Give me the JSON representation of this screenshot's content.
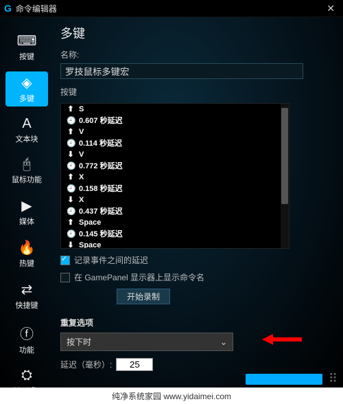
{
  "window": {
    "title": "命令编辑器"
  },
  "sidebar": {
    "items": [
      {
        "icon": "⌨",
        "label": "按键"
      },
      {
        "icon": "◈",
        "label": "多键"
      },
      {
        "icon": "A",
        "label": "文本块"
      },
      {
        "icon": "🖰",
        "label": "鼠标功能"
      },
      {
        "icon": "▶",
        "label": "媒体"
      },
      {
        "icon": "🔥",
        "label": "热键"
      },
      {
        "icon": "⇄",
        "label": "快捷键"
      },
      {
        "icon": "ⓕ",
        "label": "功能"
      },
      {
        "icon": "⛭",
        "label": "Ventrilo"
      }
    ]
  },
  "main": {
    "heading": "多键",
    "name_label": "名称:",
    "name_value": "罗技鼠标多键宏",
    "keys_label": "按键",
    "events": [
      {
        "t": "down",
        "txt": "S"
      },
      {
        "t": "delay",
        "txt": "0.607 秒延迟"
      },
      {
        "t": "down",
        "txt": "V"
      },
      {
        "t": "delay",
        "txt": "0.114 秒延迟"
      },
      {
        "t": "up",
        "txt": "V"
      },
      {
        "t": "delay",
        "txt": "0.772 秒延迟"
      },
      {
        "t": "down",
        "txt": "X"
      },
      {
        "t": "delay",
        "txt": "0.158 秒延迟"
      },
      {
        "t": "up",
        "txt": "X"
      },
      {
        "t": "delay",
        "txt": "0.437 秒延迟"
      },
      {
        "t": "down",
        "txt": "Space"
      },
      {
        "t": "delay",
        "txt": "0.145 秒延迟"
      },
      {
        "t": "up",
        "txt": "Space"
      }
    ],
    "chk_record": "记录事件之间的延迟",
    "chk_gamepanel": "在 GamePanel 显示器上显示命令名",
    "start_record": "开始录制",
    "repeat_heading": "重复选项",
    "repeat_dropdown": "按下时",
    "delay_label": "延迟（毫秒）:",
    "delay_value": "25"
  },
  "footer": {
    "text": "纯净系统家园    www.yidaimei.com"
  }
}
